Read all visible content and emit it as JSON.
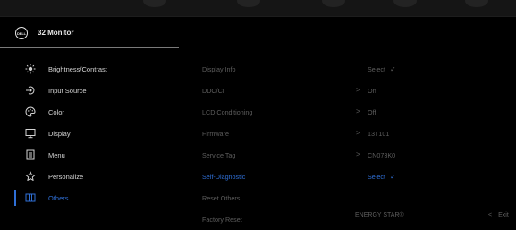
{
  "window": {
    "title": "32 Monitor",
    "logo_text": "DELL"
  },
  "sidebar": {
    "items": [
      {
        "label": "Brightness/Contrast",
        "icon": "brightness-icon"
      },
      {
        "label": "Input Source",
        "icon": "input-source-icon"
      },
      {
        "label": "Color",
        "icon": "color-palette-icon"
      },
      {
        "label": "Display",
        "icon": "display-icon"
      },
      {
        "label": "Menu",
        "icon": "menu-icon"
      },
      {
        "label": "Personalize",
        "icon": "star-icon"
      },
      {
        "label": "Others",
        "icon": "others-icon",
        "selected": true
      }
    ]
  },
  "main": {
    "rows": [
      {
        "name": "Display Info",
        "value": "Select",
        "check": "✓"
      },
      {
        "name": "DDC/CI",
        "value": "On",
        "arrow": ">"
      },
      {
        "name": "LCD Conditioning",
        "value": "Off",
        "arrow": ">"
      },
      {
        "name": "Firmware",
        "value": "13T101",
        "arrow": ">"
      },
      {
        "name": "Service Tag",
        "value": "CN073K0",
        "arrow": ">"
      },
      {
        "name": "Self-Diagnostic",
        "value": "Select",
        "check": "✓",
        "highlighted": true
      },
      {
        "name": "Reset Others"
      },
      {
        "name": "Factory Reset"
      }
    ]
  },
  "footer": {
    "energy_star": "ENERGY STAR®",
    "exit_arrow": "<",
    "exit_label": "Exit"
  },
  "colors": {
    "accent": "#2f6fd6",
    "text": "#d4d4d4",
    "muted": "#5e5e5e",
    "background": "#000000"
  }
}
